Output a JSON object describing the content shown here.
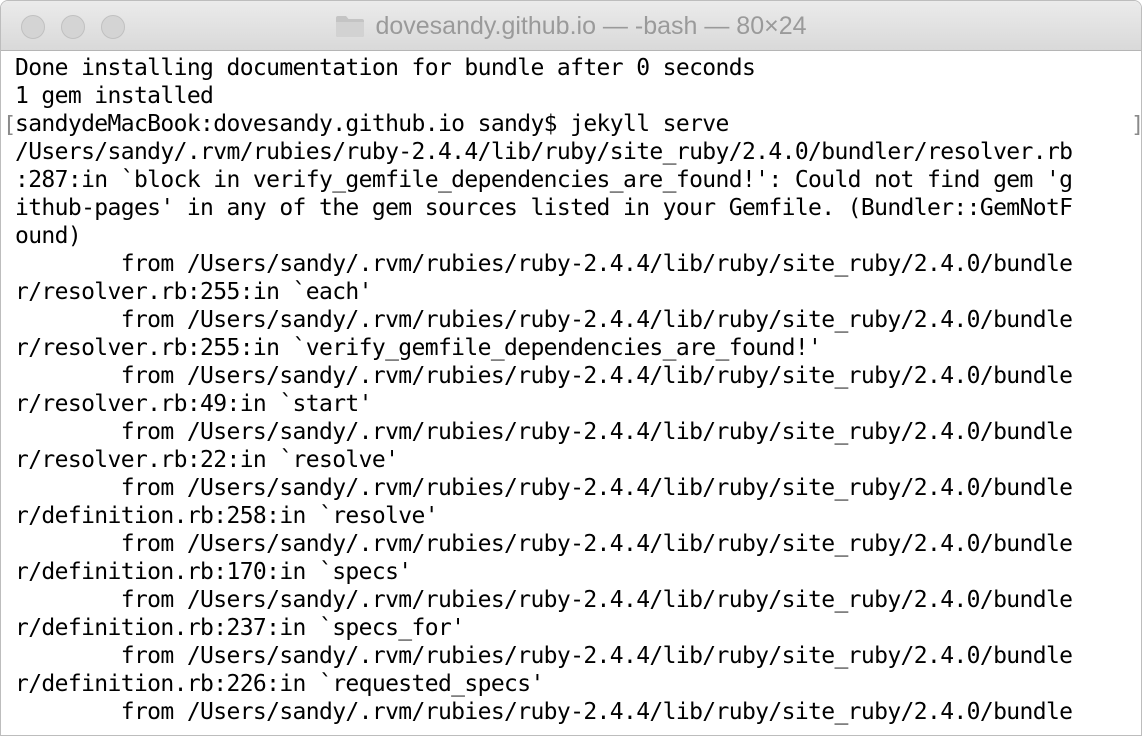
{
  "window": {
    "title": "dovesandy.github.io — -bash — 80×24",
    "title_icon": "folder-icon",
    "controls": [
      "close",
      "minimize",
      "zoom"
    ]
  },
  "colors": {
    "background": "#ffffff",
    "text": "#000000",
    "title_text": "#9a9a9a",
    "titlebar": "#e3e3e3"
  },
  "terminal": {
    "lines": [
      "Done installing documentation for bundle after 0 seconds",
      "1 gem installed",
      "sandydeMacBook:dovesandy.github.io sandy$ jekyll serve",
      "/Users/sandy/.rvm/rubies/ruby-2.4.4/lib/ruby/site_ruby/2.4.0/bundler/resolver.rb",
      ":287:in `block in verify_gemfile_dependencies_are_found!': Could not find gem 'g",
      "ithub-pages' in any of the gem sources listed in your Gemfile. (Bundler::GemNotF",
      "ound)",
      "        from /Users/sandy/.rvm/rubies/ruby-2.4.4/lib/ruby/site_ruby/2.4.0/bundle",
      "r/resolver.rb:255:in `each'",
      "        from /Users/sandy/.rvm/rubies/ruby-2.4.4/lib/ruby/site_ruby/2.4.0/bundle",
      "r/resolver.rb:255:in `verify_gemfile_dependencies_are_found!'",
      "        from /Users/sandy/.rvm/rubies/ruby-2.4.4/lib/ruby/site_ruby/2.4.0/bundle",
      "r/resolver.rb:49:in `start'",
      "        from /Users/sandy/.rvm/rubies/ruby-2.4.4/lib/ruby/site_ruby/2.4.0/bundle",
      "r/resolver.rb:22:in `resolve'",
      "        from /Users/sandy/.rvm/rubies/ruby-2.4.4/lib/ruby/site_ruby/2.4.0/bundle",
      "r/definition.rb:258:in `resolve'",
      "        from /Users/sandy/.rvm/rubies/ruby-2.4.4/lib/ruby/site_ruby/2.4.0/bundle",
      "r/definition.rb:170:in `specs'",
      "        from /Users/sandy/.rvm/rubies/ruby-2.4.4/lib/ruby/site_ruby/2.4.0/bundle",
      "r/definition.rb:237:in `specs_for'",
      "        from /Users/sandy/.rvm/rubies/ruby-2.4.4/lib/ruby/site_ruby/2.4.0/bundle",
      "r/definition.rb:226:in `requested_specs'",
      "        from /Users/sandy/.rvm/rubies/ruby-2.4.4/lib/ruby/site_ruby/2.4.0/bundle"
    ]
  }
}
